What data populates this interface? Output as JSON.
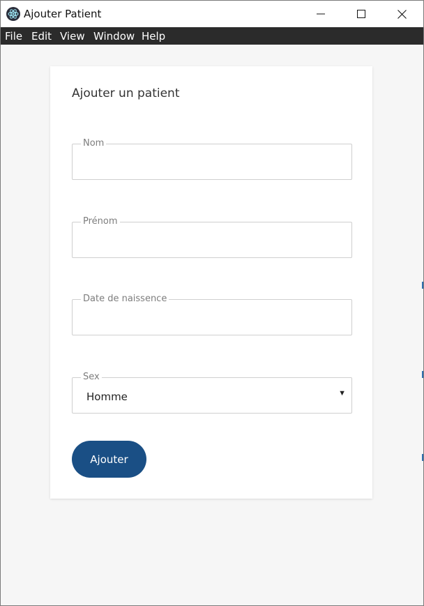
{
  "window": {
    "title": "Ajouter Patient",
    "controls": {
      "minimize": "minimize-icon",
      "maximize": "maximize-icon",
      "close": "close-icon"
    }
  },
  "menu": [
    "File",
    "Edit",
    "View",
    "Window",
    "Help"
  ],
  "form": {
    "title": "Ajouter un patient",
    "fields": {
      "nom": {
        "label": "Nom",
        "value": ""
      },
      "prenom": {
        "label": "Prénom",
        "value": ""
      },
      "date": {
        "label": "Date de naissence",
        "value": ""
      },
      "sex": {
        "label": "Sex",
        "selected": "Homme"
      }
    },
    "submit_label": "Ajouter"
  },
  "colors": {
    "accent": "#1a4f85",
    "menubar": "#2b2b2b",
    "background": "#f6f6f6"
  }
}
